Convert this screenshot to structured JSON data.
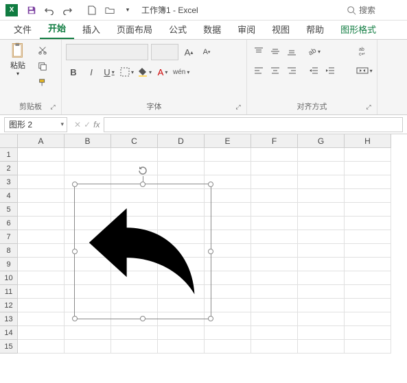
{
  "titlebar": {
    "app_initial": "X",
    "title": "工作簿1 - Excel",
    "search_label": "搜索"
  },
  "tabs": {
    "file": "文件",
    "home": "开始",
    "insert": "插入",
    "page_layout": "页面布局",
    "formulas": "公式",
    "data": "数据",
    "review": "审阅",
    "view": "视图",
    "help": "帮助",
    "shape_format": "图形格式"
  },
  "ribbon": {
    "clipboard": {
      "paste": "粘贴",
      "label": "剪贴板"
    },
    "font": {
      "label": "字体",
      "bold": "B",
      "italic": "I",
      "underline": "U",
      "wen": "wén"
    },
    "alignment": {
      "label": "对齐方式"
    }
  },
  "namebox": {
    "value": "图形 2",
    "fx": "fx"
  },
  "grid": {
    "cols": [
      "A",
      "B",
      "C",
      "D",
      "E",
      "F",
      "G",
      "H"
    ],
    "rows": [
      "1",
      "2",
      "3",
      "4",
      "5",
      "6",
      "7",
      "8",
      "9",
      "10",
      "11",
      "12",
      "13",
      "14",
      "15"
    ]
  }
}
